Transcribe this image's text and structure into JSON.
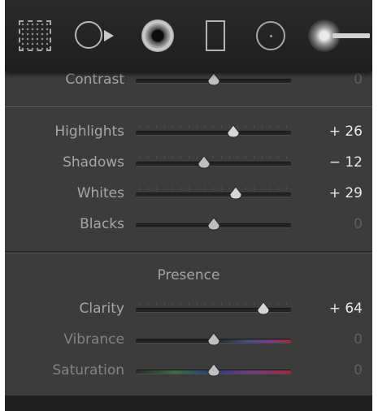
{
  "toolbar": {
    "tools": [
      {
        "icon": "crop-overlay-icon"
      },
      {
        "icon": "spot-removal-icon"
      },
      {
        "icon": "red-eye-icon"
      },
      {
        "icon": "graduated-filter-icon"
      },
      {
        "icon": "radial-filter-icon"
      },
      {
        "icon": "adjustment-brush-icon"
      }
    ]
  },
  "tone": {
    "contrast": {
      "label": "Contrast",
      "value": "0",
      "position": 0.5
    },
    "highlights": {
      "label": "Highlights",
      "value": "+ 26",
      "position": 0.63
    },
    "shadows": {
      "label": "Shadows",
      "value": "− 12",
      "position": 0.44
    },
    "whites": {
      "label": "Whites",
      "value": "+ 29",
      "position": 0.645
    },
    "blacks": {
      "label": "Blacks",
      "value": "0",
      "position": 0.5
    }
  },
  "presence": {
    "title": "Presence",
    "clarity": {
      "label": "Clarity",
      "value": "+ 64",
      "position": 0.82
    },
    "vibrance": {
      "label": "Vibrance",
      "value": "0",
      "position": 0.5
    },
    "saturation": {
      "label": "Saturation",
      "value": "0",
      "position": 0.5
    }
  }
}
